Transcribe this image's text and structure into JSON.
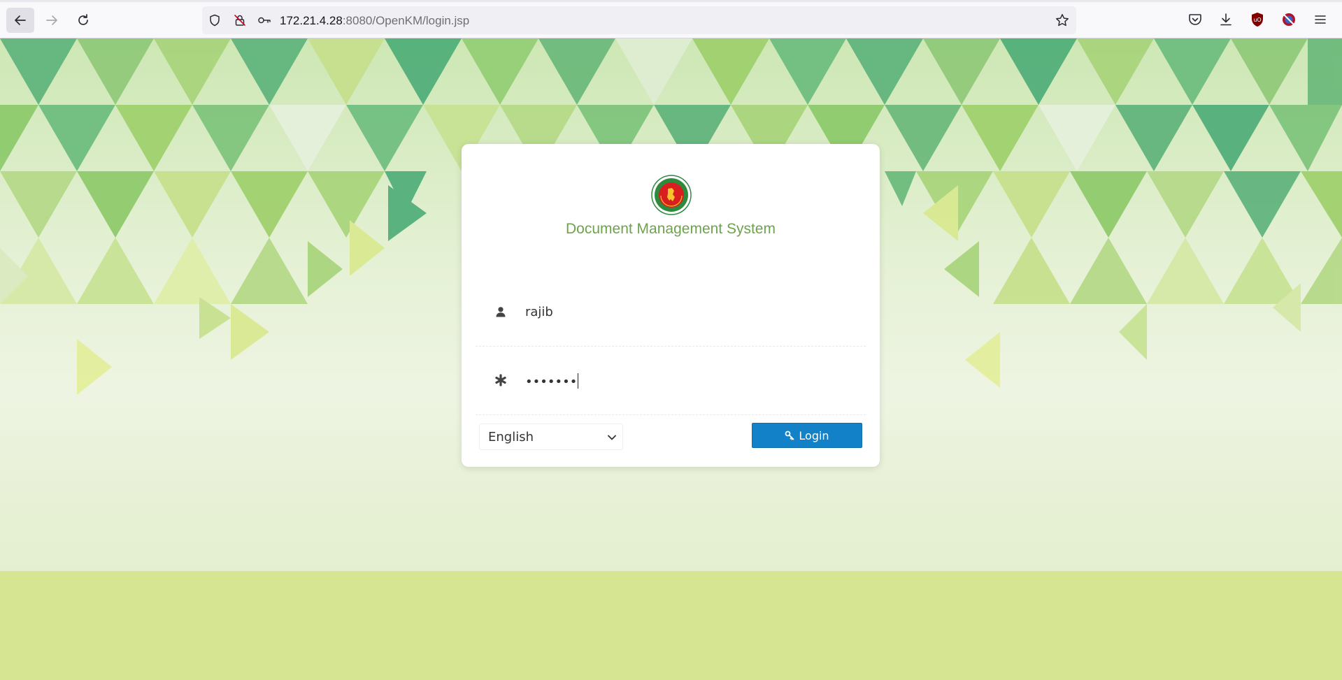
{
  "browser": {
    "url_host": "172.21.4.28",
    "url_path": ":8080/OpenKM/login.jsp",
    "icons": {
      "back": "arrow-left-icon",
      "forward": "arrow-right-icon",
      "reload": "reload-icon",
      "tracking": "shield-icon",
      "insecure": "insecure-lock-icon",
      "permissions": "key-icon",
      "bookmark": "star-icon",
      "pocket": "pocket-icon",
      "downloads": "download-icon",
      "ublock": "ublock-icon",
      "extension": "extension-icon",
      "menu": "hamburger-menu-icon"
    }
  },
  "login": {
    "title": "Document Management System",
    "username_value": "rajib",
    "password_masked": "•••••••",
    "language_selected": "English",
    "login_label": "Login",
    "colors": {
      "title": "#6da34d",
      "button": "#1381c8",
      "footer_band": "#d6e592"
    }
  }
}
